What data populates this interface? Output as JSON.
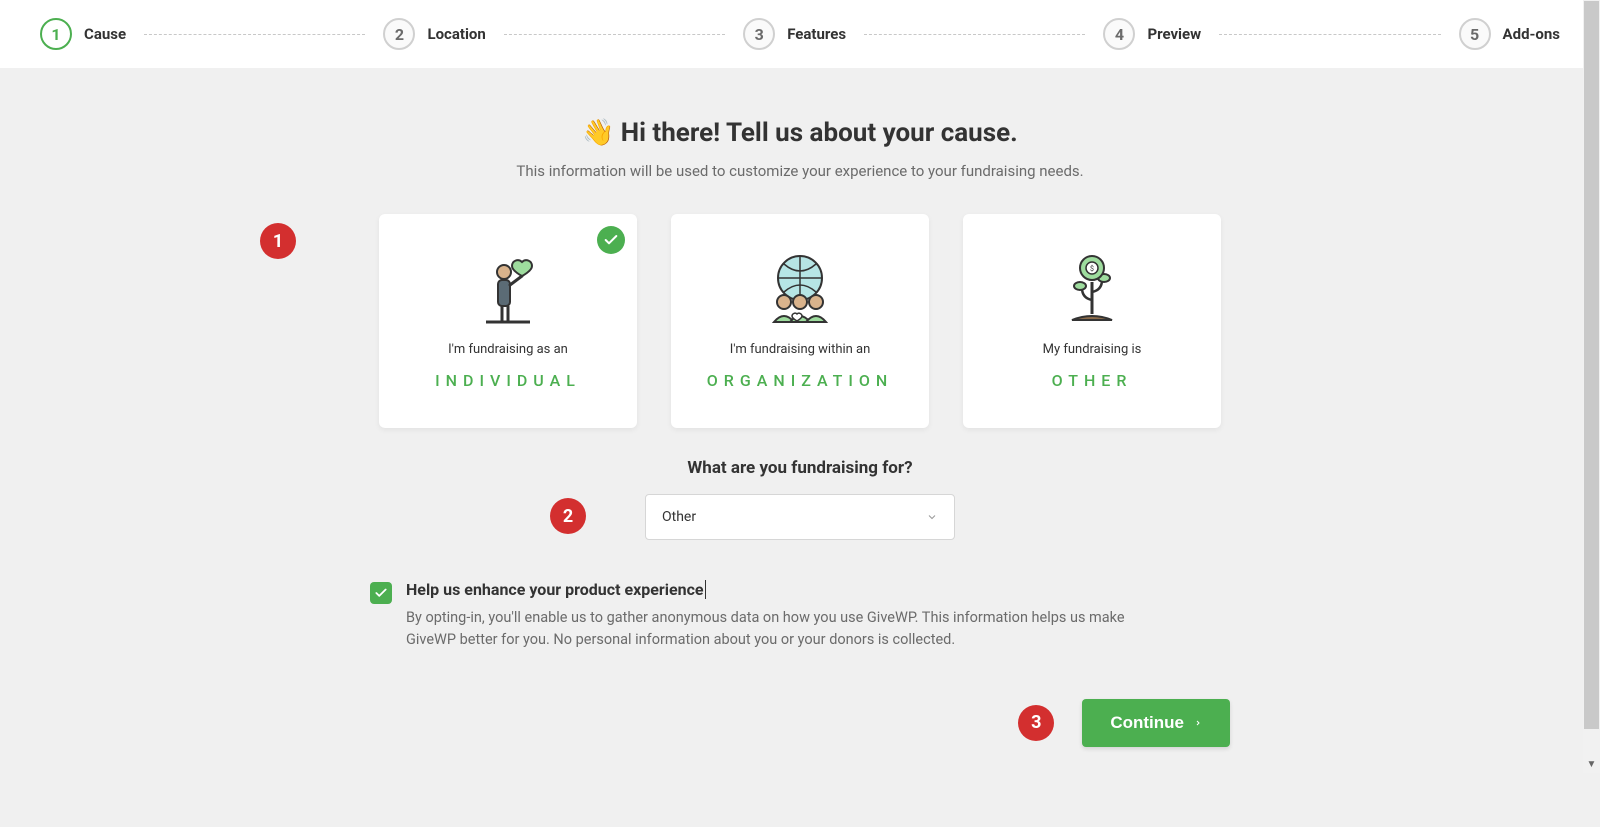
{
  "stepper": {
    "steps": [
      {
        "num": "1",
        "label": "Cause",
        "active": true
      },
      {
        "num": "2",
        "label": "Location",
        "active": false
      },
      {
        "num": "3",
        "label": "Features",
        "active": false
      },
      {
        "num": "4",
        "label": "Preview",
        "active": false
      },
      {
        "num": "5",
        "label": "Add-ons",
        "active": false
      }
    ]
  },
  "heading_emoji": "👋",
  "heading": "Hi there! Tell us about your cause.",
  "subheading": "This information will be used to customize your experience to your fundraising needs.",
  "cards": [
    {
      "pretitle": "I'm fundraising as an",
      "title": "INDIVIDUAL",
      "selected": true
    },
    {
      "pretitle": "I'm fundraising within an",
      "title": "ORGANIZATION",
      "selected": false
    },
    {
      "pretitle": "My fundraising is",
      "title": "OTHER",
      "selected": false
    }
  ],
  "question": "What are you fundraising for?",
  "select_value": "Other",
  "optin": {
    "title": "Help us enhance your product experience",
    "desc": "By opting-in, you'll enable us to gather anonymous data on how you use GiveWP. This information helps us make GiveWP better for you. No personal information about you or your donors is collected.",
    "checked": true
  },
  "continue_label": "Continue",
  "annotations": {
    "b1": "1",
    "b2": "2",
    "b3": "3"
  }
}
